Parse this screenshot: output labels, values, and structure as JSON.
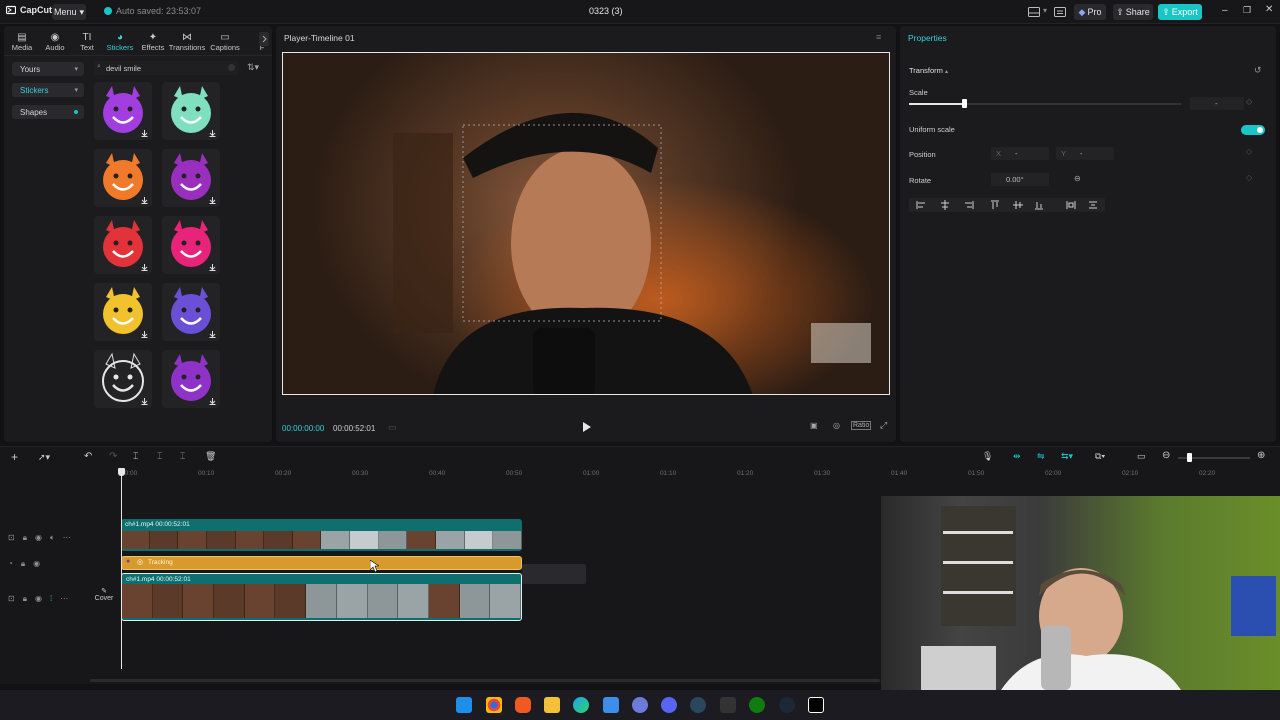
{
  "app": {
    "brand": "CapCut",
    "menu_label": "Menu",
    "autosave_text": "Auto saved: 23:53:07",
    "project_title": "0323 (3)",
    "pro_label": "Pro",
    "share_label": "Share",
    "export_label": "Export",
    "accent_color": "#19c6c6"
  },
  "toolbar": {
    "tabs": [
      {
        "label": "Media",
        "icon": "media-icon"
      },
      {
        "label": "Audio",
        "icon": "audio-icon"
      },
      {
        "label": "Text",
        "icon": "text-icon"
      },
      {
        "label": "Stickers",
        "icon": "stickers-icon",
        "active": true
      },
      {
        "label": "Effects",
        "icon": "effects-icon"
      },
      {
        "label": "Transitions",
        "icon": "transitions-icon"
      },
      {
        "label": "Captions",
        "icon": "captions-icon"
      },
      {
        "label": "F",
        "icon": "filters-icon"
      }
    ]
  },
  "sidebar": {
    "items": [
      {
        "label": "Yours"
      },
      {
        "label": "Stickers",
        "selected": true
      },
      {
        "label": "Shapes"
      }
    ]
  },
  "search": {
    "value": "devil smile"
  },
  "stickers": [
    {
      "name": "purple-devil-grin",
      "color": "#a23ee0"
    },
    {
      "name": "mint-devil-smirk",
      "color": "#7fe0c0"
    },
    {
      "name": "orange-devil-grin",
      "color": "#f07a2a"
    },
    {
      "name": "purple-devil-laugh",
      "color": "#9a2fbf"
    },
    {
      "name": "red-devil-smirk",
      "color": "#e2323a"
    },
    {
      "name": "pink-devil-laugh",
      "color": "#e8237a"
    },
    {
      "name": "yellow-devil-sunglasses",
      "color": "#f2c12e"
    },
    {
      "name": "purple-devil-cute",
      "color": "#6b4fd6"
    },
    {
      "name": "outline-devil",
      "color": "#e6e6e6"
    },
    {
      "name": "purple-devil-angry",
      "color": "#8f33c8"
    }
  ],
  "player": {
    "title": "Player-Timeline 01",
    "current_time": "00:00:00:00",
    "total_time": "00:00:52:01"
  },
  "properties": {
    "title": "Properties",
    "section": "Transform",
    "scale_label": "Scale",
    "scale_value": "-",
    "uniform_scale_label": "Uniform scale",
    "position_label": "Position",
    "x_label": "X",
    "x_value": "-",
    "y_label": "Y",
    "y_value": "-",
    "rotate_label": "Rotate",
    "rotate_value": "0.00°"
  },
  "timeline": {
    "ticks": [
      "00:00",
      "00:10",
      "00:20",
      "00:30",
      "00:40",
      "00:50",
      "01:00",
      "01:10",
      "01:20",
      "01:30",
      "01:40",
      "01:50",
      "02:00",
      "02:10",
      "02:20"
    ],
    "track1_label": "ch#1.mp4  00:00:52:01",
    "tracking_label": "Tracking",
    "track2_label": "ch#1.mp4  00:00:52:01",
    "cover_label": "Cover"
  }
}
